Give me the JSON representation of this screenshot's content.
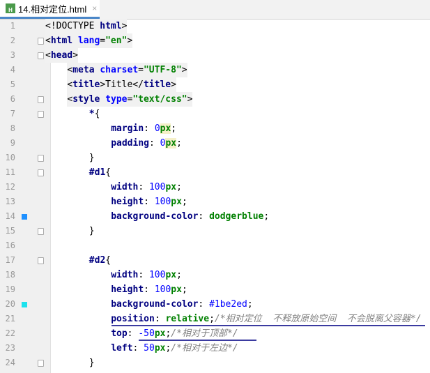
{
  "tab": {
    "title": "14.相对定位.html",
    "icon": "html-file-icon",
    "close": "×"
  },
  "markers": {
    "14": "#1e90ff",
    "20": "#1be2ed"
  },
  "folds": [
    2,
    3,
    6,
    7,
    10,
    11,
    15,
    17,
    24
  ],
  "lines": [
    {
      "n": "1",
      "i": 0,
      "bg": true,
      "t": [
        [
          "text",
          "<!DOCTYPE "
        ],
        [
          "tag",
          "html"
        ],
        [
          "text",
          ">"
        ]
      ]
    },
    {
      "n": "2",
      "i": 0,
      "bg": true,
      "t": [
        [
          "text",
          "<"
        ],
        [
          "tag",
          "html "
        ],
        [
          "attr",
          "lang"
        ],
        [
          "text",
          "="
        ],
        [
          "str",
          "\"en\""
        ],
        [
          "text",
          ">"
        ]
      ]
    },
    {
      "n": "3",
      "i": 0,
      "bg": true,
      "t": [
        [
          "text",
          "<"
        ],
        [
          "tag",
          "head"
        ],
        [
          "text",
          ">"
        ]
      ]
    },
    {
      "n": "4",
      "i": 4,
      "bg": true,
      "t": [
        [
          "text",
          "<"
        ],
        [
          "tag",
          "meta "
        ],
        [
          "attr",
          "charset"
        ],
        [
          "text",
          "="
        ],
        [
          "str",
          "\"UTF-8\""
        ],
        [
          "text",
          ">"
        ]
      ]
    },
    {
      "n": "5",
      "i": 4,
      "bg": true,
      "t": [
        [
          "text",
          "<"
        ],
        [
          "tag",
          "title"
        ],
        [
          "text",
          ">Title</"
        ],
        [
          "tag",
          "title"
        ],
        [
          "text",
          ">"
        ]
      ]
    },
    {
      "n": "6",
      "i": 4,
      "bg": true,
      "t": [
        [
          "text",
          "<"
        ],
        [
          "tag",
          "style "
        ],
        [
          "attr",
          "type"
        ],
        [
          "text",
          "="
        ],
        [
          "str",
          "\"text/css\""
        ],
        [
          "text",
          ">"
        ]
      ]
    },
    {
      "n": "7",
      "i": 8,
      "t": [
        [
          "sel",
          "*"
        ],
        [
          "text",
          "{"
        ]
      ]
    },
    {
      "n": "8",
      "i": 12,
      "t": [
        [
          "prop",
          "margin"
        ],
        [
          "text",
          ": "
        ],
        [
          "num",
          "0"
        ],
        [
          "unit hl",
          "px"
        ],
        [
          "text",
          ";"
        ]
      ]
    },
    {
      "n": "9",
      "i": 12,
      "t": [
        [
          "prop",
          "padding"
        ],
        [
          "text",
          ": "
        ],
        [
          "num",
          "0"
        ],
        [
          "unit hl",
          "px"
        ],
        [
          "text",
          ";"
        ]
      ]
    },
    {
      "n": "10",
      "i": 8,
      "t": [
        [
          "text",
          "}"
        ]
      ]
    },
    {
      "n": "11",
      "i": 8,
      "t": [
        [
          "sel",
          "#d1"
        ],
        [
          "text",
          "{"
        ]
      ]
    },
    {
      "n": "12",
      "i": 12,
      "t": [
        [
          "prop",
          "width"
        ],
        [
          "text",
          ": "
        ],
        [
          "num",
          "100"
        ],
        [
          "unit",
          "px"
        ],
        [
          "text",
          ";"
        ]
      ]
    },
    {
      "n": "13",
      "i": 12,
      "t": [
        [
          "prop",
          "height"
        ],
        [
          "text",
          ": "
        ],
        [
          "num",
          "100"
        ],
        [
          "unit",
          "px"
        ],
        [
          "text",
          ";"
        ]
      ]
    },
    {
      "n": "14",
      "i": 12,
      "t": [
        [
          "prop",
          "background-color"
        ],
        [
          "text",
          ": "
        ],
        [
          "str",
          "dodgerblue"
        ],
        [
          "text",
          ";"
        ]
      ]
    },
    {
      "n": "15",
      "i": 8,
      "t": [
        [
          "text",
          "}"
        ]
      ]
    },
    {
      "n": "16",
      "i": 0,
      "t": []
    },
    {
      "n": "17",
      "i": 8,
      "t": [
        [
          "sel",
          "#d2"
        ],
        [
          "text",
          "{"
        ]
      ]
    },
    {
      "n": "18",
      "i": 12,
      "t": [
        [
          "prop",
          "width"
        ],
        [
          "text",
          ": "
        ],
        [
          "num",
          "100"
        ],
        [
          "unit",
          "px"
        ],
        [
          "text",
          ";"
        ]
      ]
    },
    {
      "n": "19",
      "i": 12,
      "t": [
        [
          "prop",
          "height"
        ],
        [
          "text",
          ": "
        ],
        [
          "num",
          "100"
        ],
        [
          "unit",
          "px"
        ],
        [
          "text",
          ";"
        ]
      ]
    },
    {
      "n": "20",
      "i": 12,
      "t": [
        [
          "prop",
          "background-color"
        ],
        [
          "text",
          ": "
        ],
        [
          "num",
          "#1be2ed"
        ],
        [
          "text",
          ";"
        ]
      ]
    },
    {
      "n": "21",
      "i": 12,
      "t": [
        [
          "prop",
          "position"
        ],
        [
          "text",
          ": "
        ],
        [
          "str",
          "relative"
        ],
        [
          "text",
          ";"
        ],
        [
          "comment",
          "/*相对定位  不释放原始空间  不会脱离父容器*/"
        ]
      ]
    },
    {
      "n": "22",
      "i": 12,
      "t": [
        [
          "prop",
          "top"
        ],
        [
          "text",
          ": "
        ],
        [
          "num",
          "-50"
        ],
        [
          "unit",
          "px"
        ],
        [
          "text",
          ";"
        ],
        [
          "comment",
          "/*相对于顶部*/"
        ]
      ]
    },
    {
      "n": "23",
      "i": 12,
      "t": [
        [
          "prop",
          "left"
        ],
        [
          "text",
          ": "
        ],
        [
          "num",
          "50"
        ],
        [
          "unit",
          "px"
        ],
        [
          "text",
          ";"
        ],
        [
          "comment",
          "/*相对于左边*/"
        ]
      ]
    },
    {
      "n": "24",
      "i": 8,
      "t": [
        [
          "text",
          "}"
        ]
      ]
    }
  ]
}
